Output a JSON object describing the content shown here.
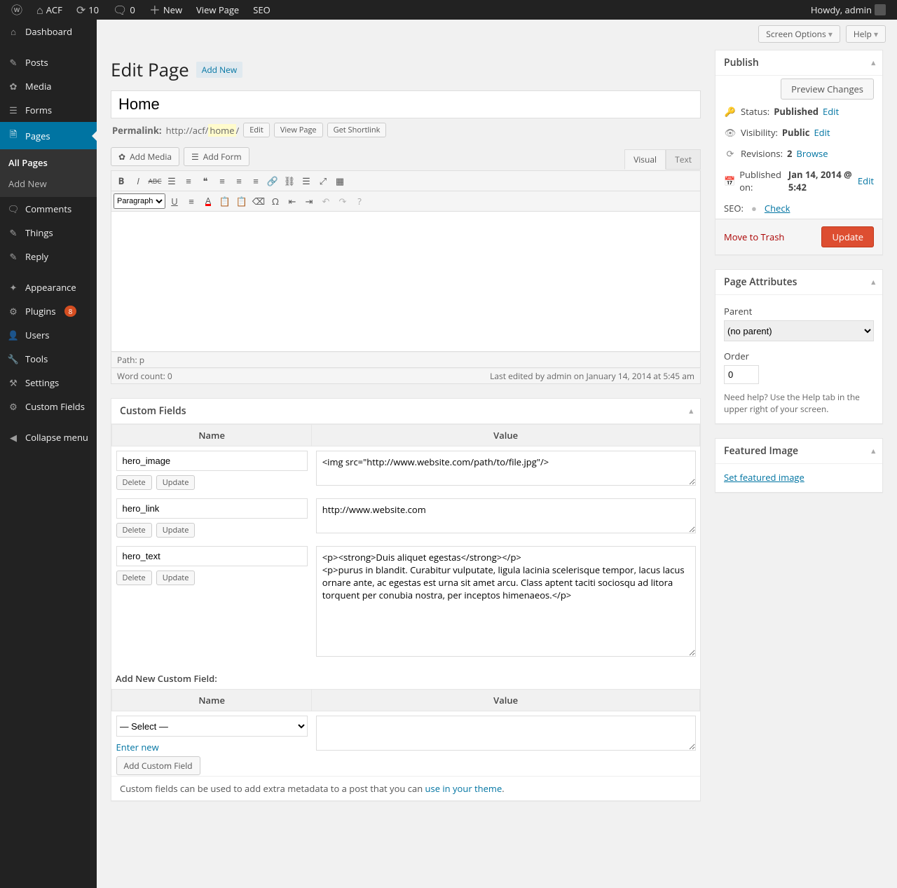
{
  "adminbar": {
    "site_name": "ACF",
    "updates_count": "10",
    "comments_count": "0",
    "new_label": "New",
    "view_page": "View Page",
    "seo": "SEO",
    "howdy": "Howdy, admin"
  },
  "menu": {
    "dashboard": "Dashboard",
    "posts": "Posts",
    "media": "Media",
    "forms": "Forms",
    "pages": "Pages",
    "all_pages": "All Pages",
    "add_new": "Add New",
    "comments": "Comments",
    "things": "Things",
    "reply": "Reply",
    "appearance": "Appearance",
    "plugins": "Plugins",
    "plugins_badge": "8",
    "users": "Users",
    "tools": "Tools",
    "settings": "Settings",
    "custom_fields": "Custom Fields",
    "collapse": "Collapse menu"
  },
  "screen": {
    "options": "Screen Options",
    "help": "Help"
  },
  "page": {
    "heading": "Edit Page",
    "add_new": "Add New",
    "title": "Home",
    "permalink_label": "Permalink:",
    "permalink_base": "http://acf/",
    "permalink_slug": "home",
    "permalink_tail": "/",
    "edit_btn": "Edit",
    "view_btn": "View Page",
    "shortlink_btn": "Get Shortlink",
    "add_media": "Add Media",
    "add_form": "Add Form",
    "tab_visual": "Visual",
    "tab_text": "Text",
    "format_select": "Paragraph",
    "path": "Path: p",
    "word_count": "Word count: 0",
    "last_edit": "Last edited by admin on January 14, 2014 at 5:45 am"
  },
  "publish": {
    "title": "Publish",
    "preview": "Preview Changes",
    "status_label": "Status:",
    "status_value": "Published",
    "visibility_label": "Visibility:",
    "visibility_value": "Public",
    "revisions_label": "Revisions:",
    "revisions_count": "2",
    "browse": "Browse",
    "published_label": "Published on:",
    "published_value": "Jan 14, 2014 @ 5:42",
    "seo_label": "SEO:",
    "seo_check": "Check",
    "edit": "Edit",
    "trash": "Move to Trash",
    "update": "Update"
  },
  "page_attr": {
    "title": "Page Attributes",
    "parent": "Parent",
    "parent_value": "(no parent)",
    "order": "Order",
    "order_value": "0",
    "help": "Need help? Use the Help tab in the upper right of your screen."
  },
  "featured": {
    "title": "Featured Image",
    "set": "Set featured image"
  },
  "cf": {
    "title": "Custom Fields",
    "col_name": "Name",
    "col_value": "Value",
    "rows": [
      {
        "name": "hero_image",
        "value": "<img src=\"http://www.website.com/path/to/file.jpg\"/>",
        "rows": 2
      },
      {
        "name": "hero_link",
        "value": "http://www.website.com",
        "rows": 2
      },
      {
        "name": "hero_text",
        "value": "<p><strong>Duis aliquet egestas</strong></p>\n<p>purus in blandit. Curabitur vulputate, ligula lacinia scelerisque tempor, lacus lacus ornare ante, ac egestas est urna sit amet arcu. Class aptent taciti sociosqu ad litora torquent per conubia nostra, per inceptos himenaeos.</p>",
        "rows": 8
      }
    ],
    "delete": "Delete",
    "update": "Update",
    "add_heading": "Add New Custom Field:",
    "select_placeholder": "— Select —",
    "enter_new": "Enter new",
    "add_btn": "Add Custom Field",
    "note_pre": "Custom fields can be used to add extra metadata to a post that you can ",
    "note_link": "use in your theme",
    "note_post": "."
  }
}
